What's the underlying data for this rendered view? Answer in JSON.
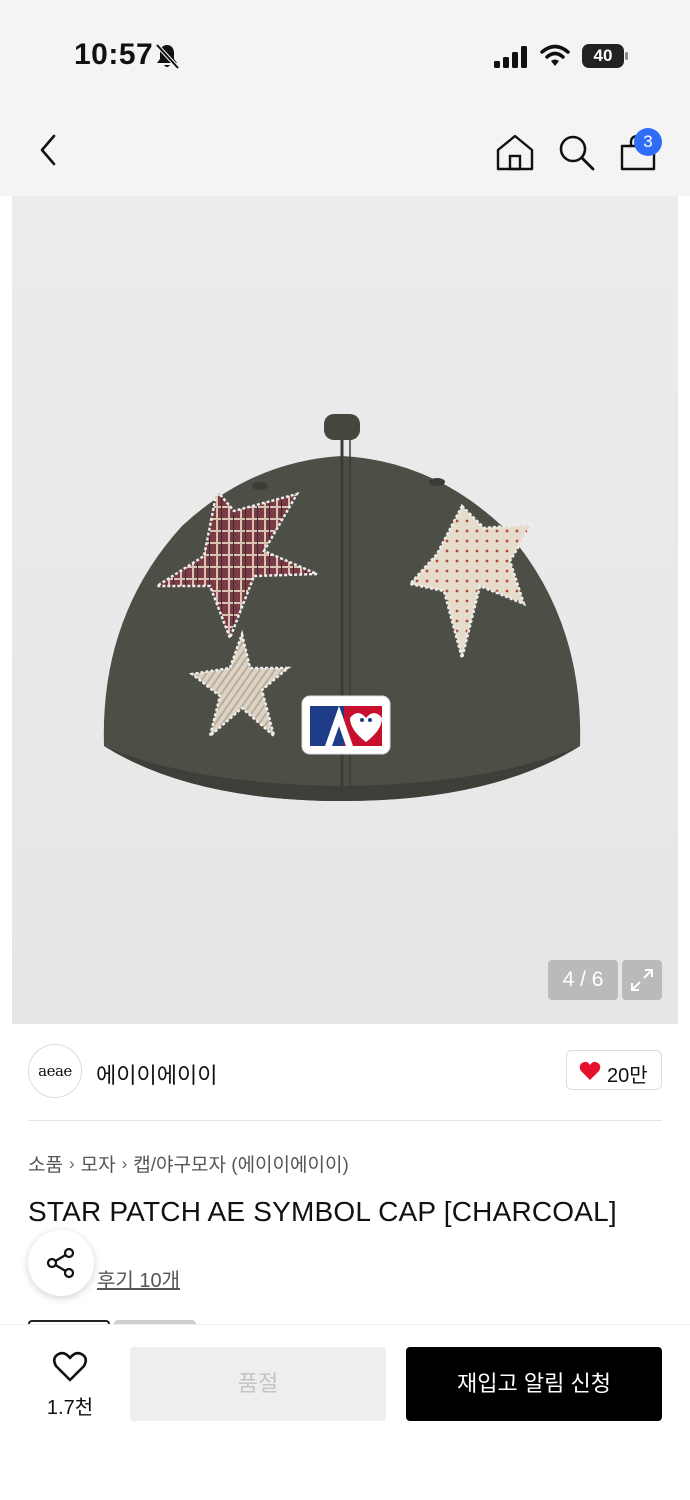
{
  "status_bar": {
    "time": "10:57",
    "battery": "40",
    "icons": [
      "bell-off-icon",
      "signal-icon",
      "wifi-icon",
      "battery-icon"
    ]
  },
  "nav": {
    "icons": [
      "back-icon",
      "home-icon",
      "search-icon",
      "shopping-bag-icon"
    ],
    "cart_badge": "3"
  },
  "gallery": {
    "counter": "4 / 6",
    "icons": [
      "expand-icon"
    ]
  },
  "brand": {
    "logo_text": "aeae",
    "name": "에이이에이이",
    "like_count": "20만"
  },
  "breadcrumb": [
    "소품",
    "모자",
    "캡/야구모자 (에이이에이이)"
  ],
  "product": {
    "title": "STAR PATCH AE SYMBOL CAP [CHARCOAL]",
    "review_link": "후기 10개"
  },
  "bottom_bar": {
    "wish_count": "1.7천",
    "soldout_label": "품절",
    "restock_label": "재입고 알림 신청"
  },
  "colors": {
    "badge": "#2f6df6",
    "heart": "#e5112b",
    "primary_button": "#000000",
    "disabled_button": "#eeeeee"
  }
}
